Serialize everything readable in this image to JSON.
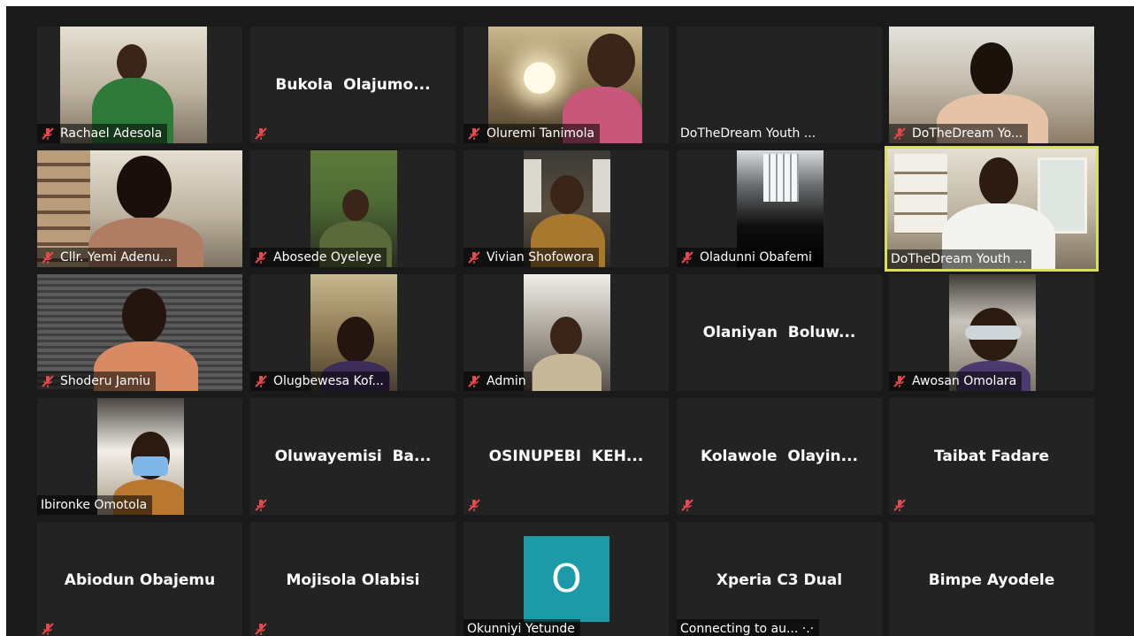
{
  "participants": [
    {
      "name": "Rachael Adesola",
      "muted": true,
      "video": true
    },
    {
      "name": "Bukola  Olajumo...",
      "muted": true,
      "video": false
    },
    {
      "name": "Oluremi Tanimola",
      "muted": true,
      "video": true
    },
    {
      "name": "DoTheDream Youth ...",
      "muted": false,
      "video": false
    },
    {
      "name": "DoTheDream Yo...",
      "muted": true,
      "video": true
    },
    {
      "name": "Cllr. Yemi Adenu...",
      "muted": true,
      "video": true
    },
    {
      "name": "Abosede Oyeleye",
      "muted": true,
      "video": true
    },
    {
      "name": "Vivian Shofowora",
      "muted": true,
      "video": true
    },
    {
      "name": "Oladunni Obafemi",
      "muted": true,
      "video": true
    },
    {
      "name": "DoTheDream Youth ...",
      "muted": false,
      "video": true,
      "active_speaker": true
    },
    {
      "name": "Shoderu Jamiu",
      "muted": true,
      "video": true
    },
    {
      "name": "Olugbewesa Kof...",
      "muted": true,
      "video": true
    },
    {
      "name": "Admin",
      "muted": true,
      "video": true
    },
    {
      "name": "Olaniyan  Boluw...",
      "muted": false,
      "video": false
    },
    {
      "name": "Awosan Omolara",
      "muted": true,
      "video": true
    },
    {
      "name": "Ibironke Omotola",
      "muted": false,
      "video": true
    },
    {
      "name": "Oluwayemisi  Ba...",
      "muted": true,
      "video": false
    },
    {
      "name": "OSINUPEBI  KEH...",
      "muted": true,
      "video": false
    },
    {
      "name": "Kolawole  Olayin...",
      "muted": true,
      "video": false
    },
    {
      "name": "Taibat Fadare",
      "muted": true,
      "video": false
    },
    {
      "name": "Abiodun Obajemu",
      "muted": true,
      "video": false
    },
    {
      "name": "Mojisola Olabisi",
      "muted": true,
      "video": false
    },
    {
      "name": "Okunniyi Yetunde",
      "muted": false,
      "video": false,
      "avatar_letter": "O"
    },
    {
      "name": "Xperia C3 Dual",
      "muted": false,
      "video": false,
      "status": "Connecting to au... ·.·"
    },
    {
      "name": "Bimpe Ayodele",
      "muted": false,
      "video": false
    }
  ],
  "colors": {
    "background": "#1a1a1a",
    "tile": "#232323",
    "active_border": "#d8e05a",
    "muted_icon": "#e5484d",
    "avatar": "#1d9aa8"
  }
}
